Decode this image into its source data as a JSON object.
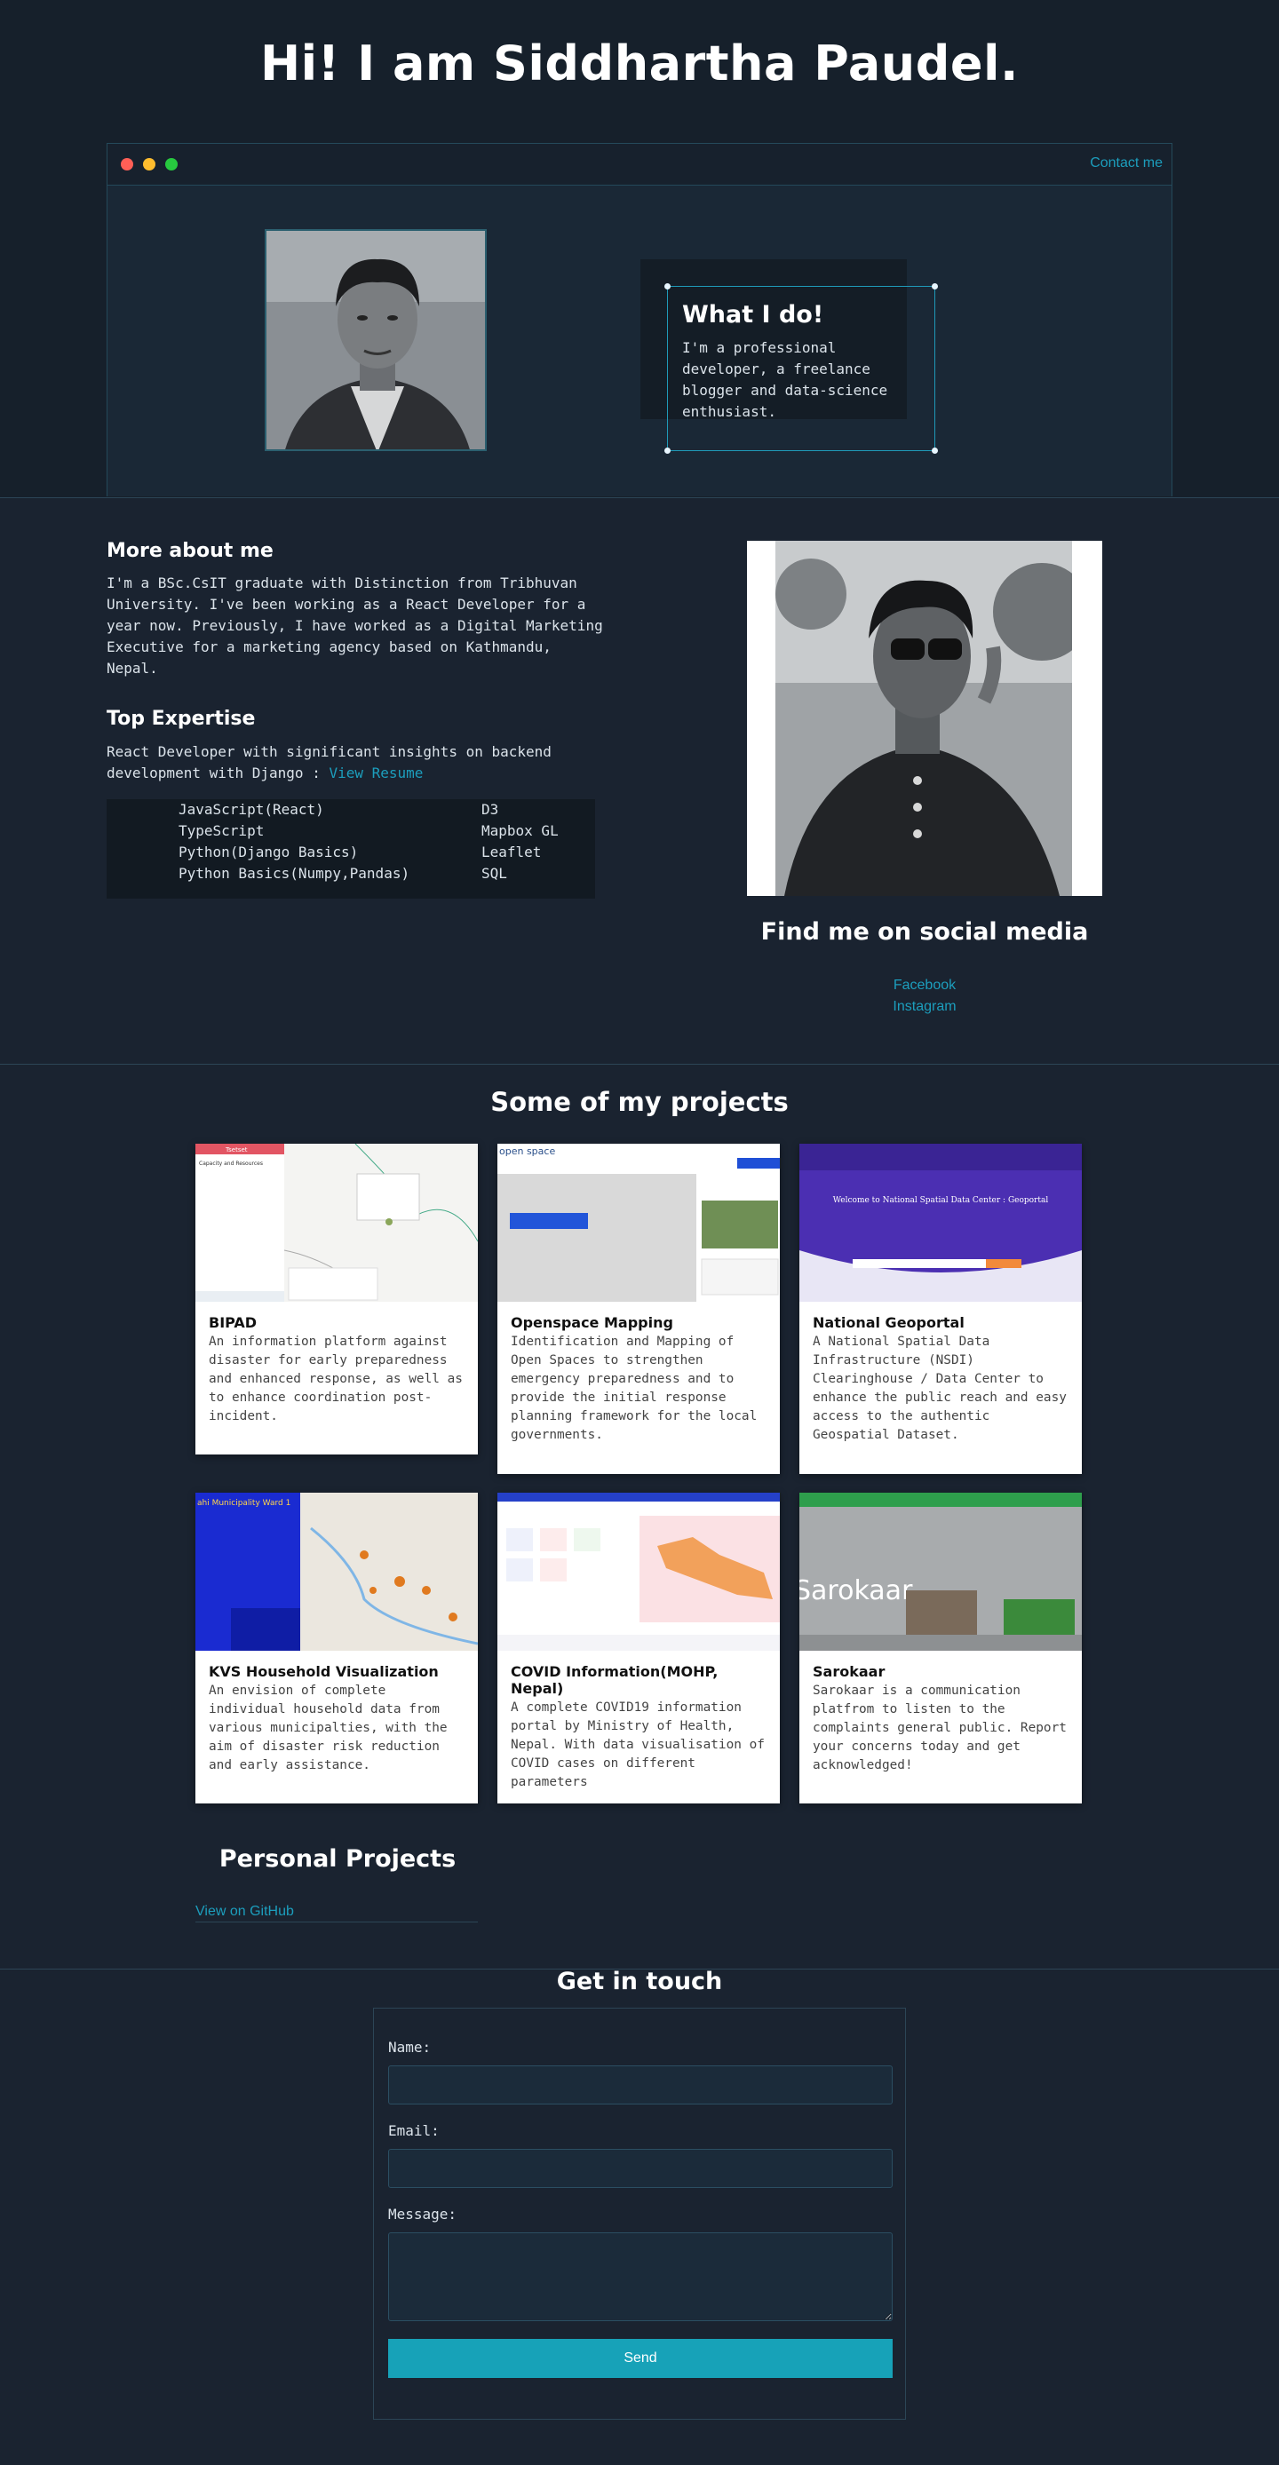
{
  "hero": {
    "title": "Hi! I am Siddhartha Paudel.",
    "contact_link": "Contact me",
    "what_title": "What I do!",
    "what_text": "I'm a professional developer, a freelance blogger and data-science enthusiast."
  },
  "about": {
    "title": "More about me",
    "text": "I'm a BSc.CsIT graduate with Distinction from Tribhuvan University. I've been working as a React Developer for a year now. Previously, I have worked as a Digital Marketing Executive for a marketing agency based on Kathmandu, Nepal.",
    "expertise_title": "Top Expertise",
    "expertise_text": "React Developer with significant insights on backend development with Django :",
    "resume_link": "View Resume",
    "skills_left": [
      "JavaScript(React)",
      "TypeScript",
      "Python(Django Basics)",
      "Python Basics(Numpy,Pandas)"
    ],
    "skills_right": [
      "D3",
      "Mapbox GL",
      "Leaflet",
      "SQL"
    ]
  },
  "social": {
    "title": "Find me on social media",
    "links": [
      "Facebook",
      "Instagram"
    ]
  },
  "projects": {
    "title": "Some of my projects",
    "items": [
      {
        "title": "BIPAD",
        "desc": "An information platform against disaster for early preparedness and enhanced response, as well as to enhance coordination post-incident."
      },
      {
        "title": "Openspace Mapping",
        "desc": "Identification and Mapping of Open Spaces to strengthen emergency preparedness and to provide the initial response planning framework for the local governments."
      },
      {
        "title": "National Geoportal",
        "desc": "A National Spatial Data Infrastructure (NSDI) Clearinghouse / Data Center to enhance the public reach and easy access to the authentic Geospatial Dataset."
      },
      {
        "title": "KVS Household Visualization",
        "desc": "An envision of complete individual household data from various municipalties, with the aim of disaster risk reduction and early assistance."
      },
      {
        "title": "COVID Information(MOHP, Nepal)",
        "desc": "A complete COVID19 information portal by Ministry of Health, Nepal. With data visualisation of COVID cases on different parameters"
      },
      {
        "title": "Sarokaar",
        "desc": "Sarokaar is a communication platfrom to listen to the complaints general public. Report your concerns today and get acknowledged!"
      }
    ]
  },
  "personal": {
    "title": "Personal Projects",
    "github_link": "View on GitHub"
  },
  "contact": {
    "title": "Get in touch",
    "name_label": "Name:",
    "email_label": "Email:",
    "message_label": "Message:",
    "send_label": "Send"
  },
  "thumb_text": {
    "bipad_header": "Tsetset",
    "bipad_panel": "Capacity and Resources",
    "openspace_logo": "open space",
    "geoportal_welcome": "Welcome to National Spatial Data Center : Geoportal",
    "kvs_header": "ahi Municipality Ward 1",
    "sarokaar_text": "Sarokaar"
  },
  "colors": {
    "accent": "#1c9ebd",
    "background": "#1a2330",
    "hero_bg": "#16202b",
    "send_button": "#17a2b8"
  }
}
